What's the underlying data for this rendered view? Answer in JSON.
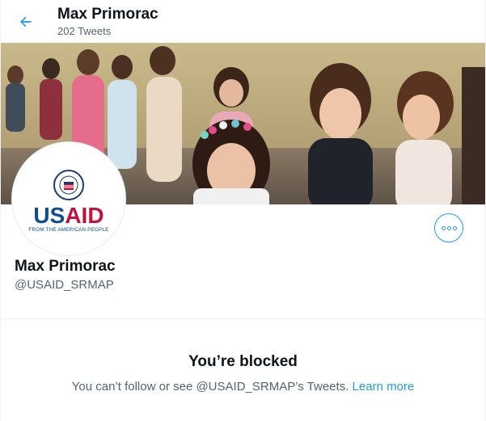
{
  "header": {
    "title": "Max Primorac",
    "subtitle": "202 Tweets",
    "back_icon": "arrow-left-icon"
  },
  "banner": {
    "image": "photo of children standing in a line in a classroom"
  },
  "avatar": {
    "logo_text_us": "US",
    "logo_text_aid": "AID",
    "logo_tagline": "FROM THE AMERICAN PEOPLE",
    "seal_text": "USAID"
  },
  "more_button": {
    "icon": "more-horizontal-icon"
  },
  "profile": {
    "name": "Max Primorac",
    "handle": "@USAID_SRMAP"
  },
  "blocked": {
    "title": "You’re blocked",
    "message": "You can’t follow or see @USAID_SRMAP’s Tweets.",
    "link": "Learn more"
  },
  "colors": {
    "accent": "#1d9bf0",
    "text": "#0f1419",
    "secondary": "#536471",
    "usaid_blue": "#0e4b8f",
    "usaid_red": "#c2113a"
  }
}
